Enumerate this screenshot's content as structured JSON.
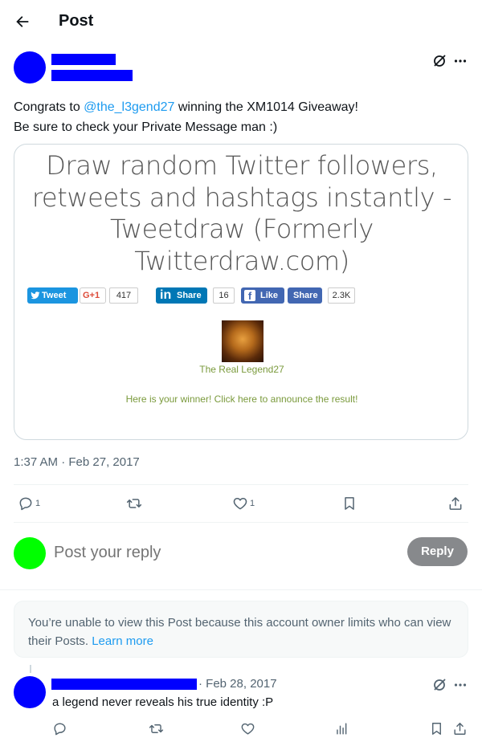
{
  "header": {
    "title": "Post"
  },
  "post": {
    "text_prefix": "Congrats to ",
    "mention": "@the_l3gend27",
    "text_suffix": " winning the XM1014 Giveaway!",
    "text_line2": "Be sure to check your Private Message man :)",
    "card": {
      "headline": "Draw random Twitter followers, retweets and hashtags instantly - Tweetdraw (Formerly Twitterdraw.com)",
      "share_buttons": {
        "tweet": "Tweet",
        "gplus": "G+1",
        "gplus_count": "417",
        "linkedin": "Share",
        "linkedin_count": "16",
        "fb_like": "Like",
        "fb_share": "Share",
        "fb_count": "2.3K"
      },
      "winner_name": "The Real Legend27",
      "announce": "Here is your winner! Click here to announce the result!"
    },
    "timestamp": "1:37 AM · Feb 27, 2017",
    "actions": {
      "replies": "1",
      "likes": "1"
    }
  },
  "composer": {
    "placeholder": "Post your reply",
    "button": "Reply"
  },
  "notice": {
    "text": "You’re unable to view this Post because this account owner limits who can view their Posts. ",
    "link": "Learn more"
  },
  "reply": {
    "date": "· Feb 28, 2017",
    "text": "a legend never reveals his true identity :P"
  },
  "colors": {
    "accent": "#1d9bf0",
    "author_avatar": "#0000ff",
    "me_avatar": "#00ff00",
    "reply_button": "#87898c"
  }
}
